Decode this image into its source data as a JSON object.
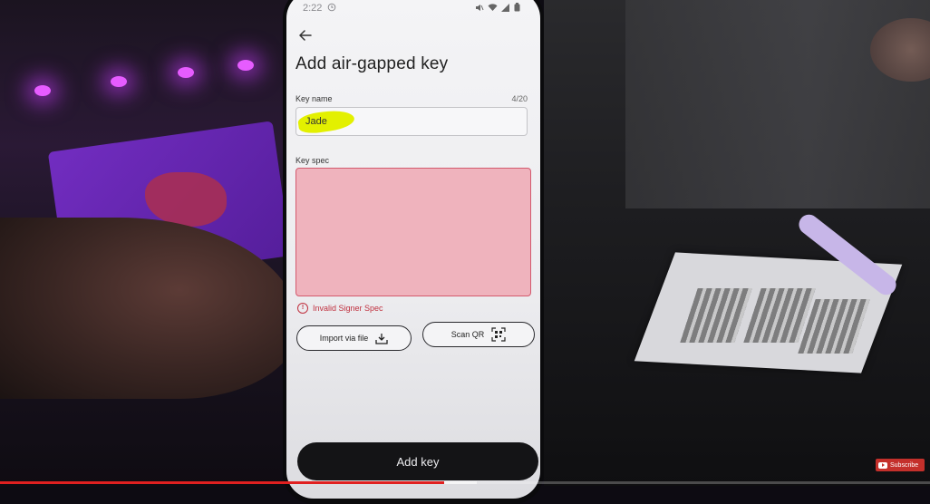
{
  "status_bar": {
    "time": "2:22"
  },
  "page": {
    "title": "Add air-gapped key"
  },
  "key_name": {
    "label": "Key name",
    "counter": "4/20",
    "value": "Jade"
  },
  "key_spec": {
    "label": "Key spec",
    "value": "",
    "error": "Invalid Signer Spec"
  },
  "actions": {
    "import_label": "Import via file",
    "scan_label": "Scan QR",
    "submit_label": "Add key"
  },
  "youtube": {
    "subscribe_label": "Subscribe",
    "progress_played": 0.478
  },
  "colors": {
    "error": "#c0313f",
    "spec_error_bg": "#efb3bd",
    "primary_button": "#141416",
    "subscribe": "#c4302b"
  }
}
